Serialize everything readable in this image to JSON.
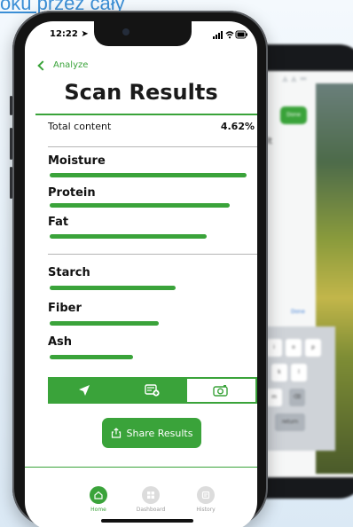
{
  "caption": {
    "text": "oku przez cały"
  },
  "status_bar": {
    "time": "12:22"
  },
  "header": {
    "back_label": "Analyze",
    "title": "Scan Results"
  },
  "summary": {
    "total_label": "Total content",
    "total_value": "4.62%"
  },
  "metrics": [
    {
      "label": "Moisture",
      "level": 0.94
    },
    {
      "label": "Protein",
      "level": 0.86
    },
    {
      "label": "Fat",
      "level": 0.75
    },
    {
      "label": "Starch",
      "level": 0.6
    },
    {
      "label": "Fiber",
      "level": 0.52
    },
    {
      "label": "Ash",
      "level": 0.4
    }
  ],
  "share": {
    "label": "Share Results"
  },
  "nav": {
    "items": [
      {
        "label": "Home",
        "icon": "home-icon",
        "active": true
      },
      {
        "label": "Dashboard",
        "icon": "dashboard-icon",
        "active": false
      },
      {
        "label": "History",
        "icon": "history-icon",
        "active": false
      }
    ]
  },
  "background_phone": {
    "done_button": "Done",
    "partial_text": "ult",
    "done_text": "Done",
    "keys": [
      "i",
      "o",
      "p",
      "k",
      "l",
      "m",
      "return"
    ]
  },
  "colors": {
    "accent": "#3aa33a",
    "caption": "#3b8fd6"
  }
}
